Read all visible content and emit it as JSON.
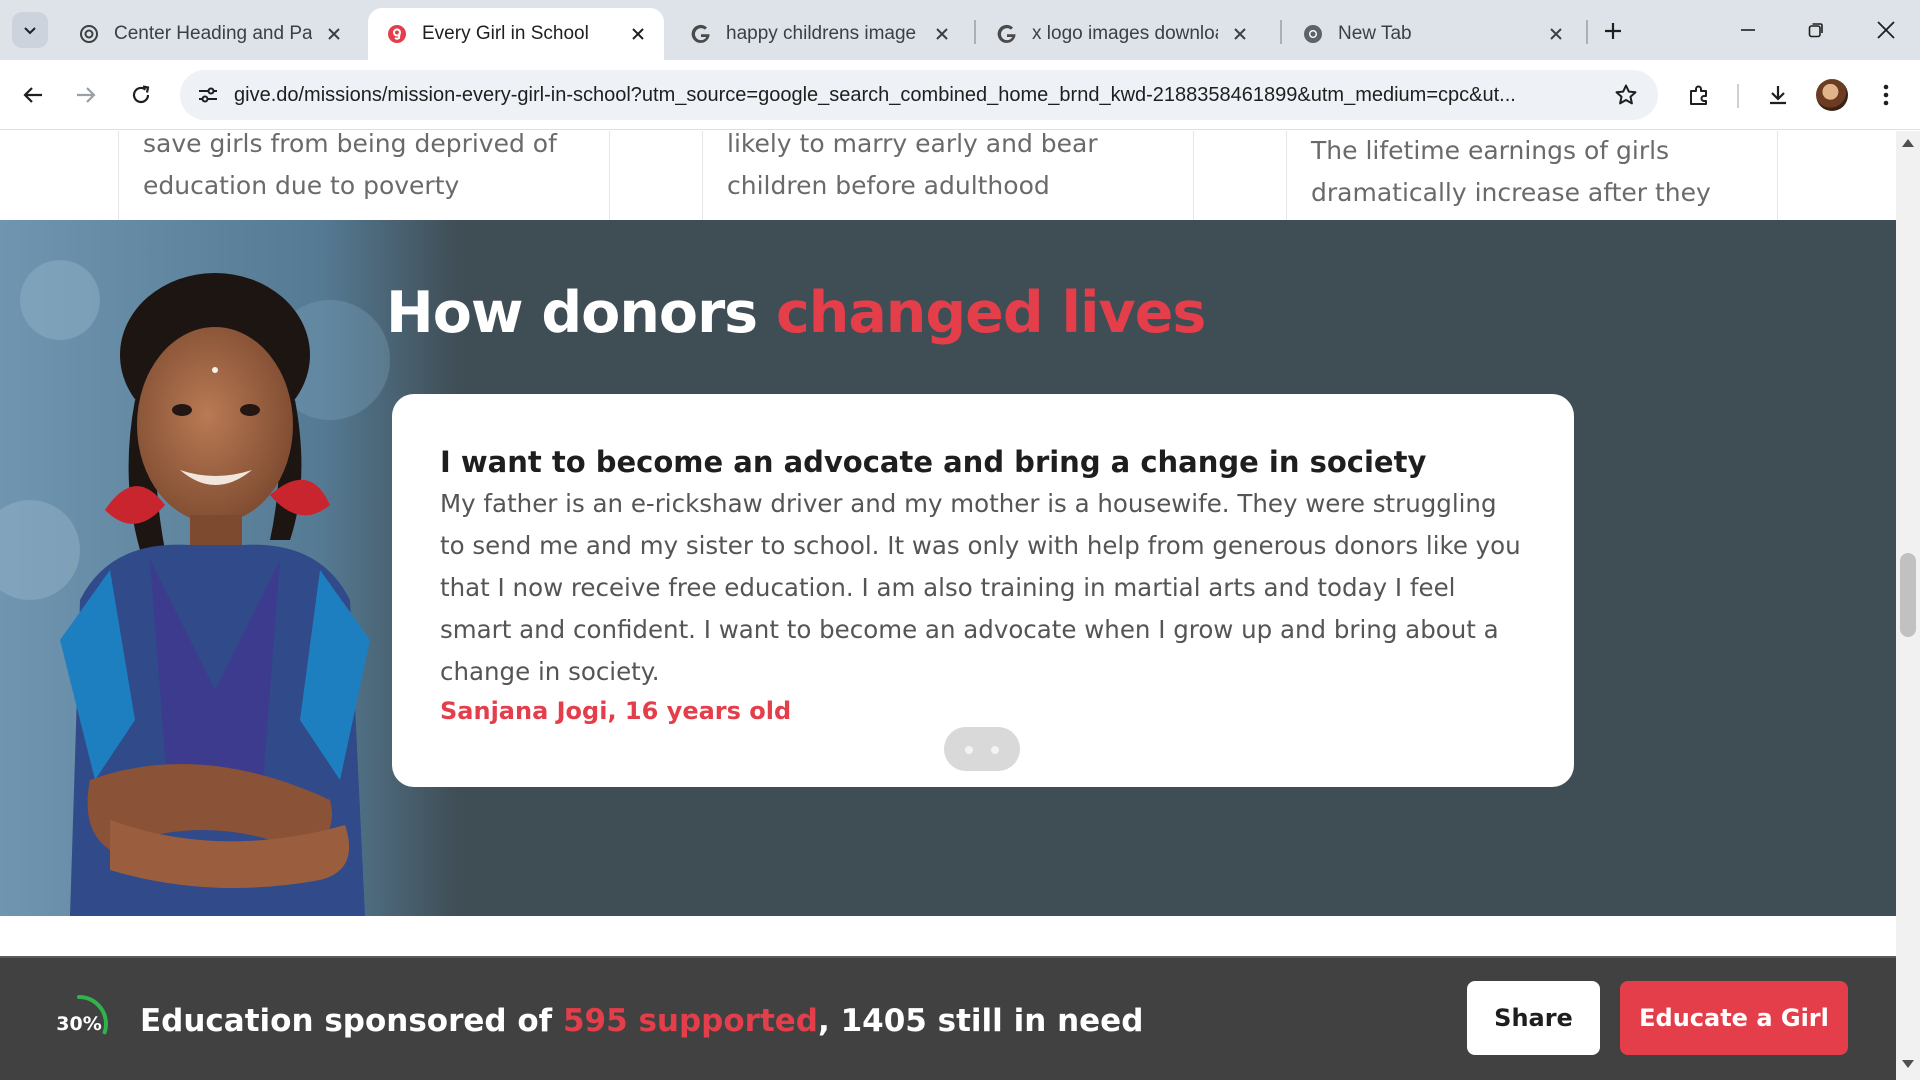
{
  "browser": {
    "tabs": [
      {
        "title": "Center Heading and Para",
        "favicon": "chatgpt-icon",
        "active": false
      },
      {
        "title": "Every Girl in School",
        "favicon": "give-icon",
        "active": true
      },
      {
        "title": "happy childrens image ho",
        "favicon": "google-icon",
        "active": false
      },
      {
        "title": "x logo images download",
        "favicon": "google-icon",
        "active": false
      },
      {
        "title": "New Tab",
        "favicon": "chrome-icon",
        "active": false
      }
    ],
    "url": "give.do/missions/mission-every-girl-in-school?utm_source=google_search_combined_home_brnd_kwd-2188358461899&utm_medium=cpc&ut..."
  },
  "stats": {
    "items": [
      {
        "line1": "save girls from being deprived of",
        "line2": "education due to poverty"
      },
      {
        "line1": "likely to marry early and bear",
        "line2": "children before adulthood"
      },
      {
        "line1": "The lifetime earnings of girls",
        "line2": "dramatically increase after they"
      }
    ]
  },
  "stories": {
    "heading_main": "How donors ",
    "heading_accent": "changed lives",
    "accent_color": "#e53e4b",
    "section_bg": "#3f4d55",
    "card": {
      "title": "I want to become an advocate and bring a change in society",
      "body": "My father is an e-rickshaw driver and my mother is a housewife. They were struggling to send me and my sister to school. It was only with help from generous donors like you that I now receive free education. I am also training in martial arts and today I feel smart and confident. I want to become an advocate when I grow up and bring about a change in society.",
      "author": "Sanjana Jogi, 16 years old"
    },
    "carousel_dots": 2
  },
  "footer": {
    "progress_percent": 30,
    "progress_label": "30%",
    "text_prefix": "Education sponsored of ",
    "text_accent": "595 supported",
    "text_suffix": ", 1405 still in need",
    "share_label": "Share",
    "educate_label": "Educate a Girl"
  }
}
